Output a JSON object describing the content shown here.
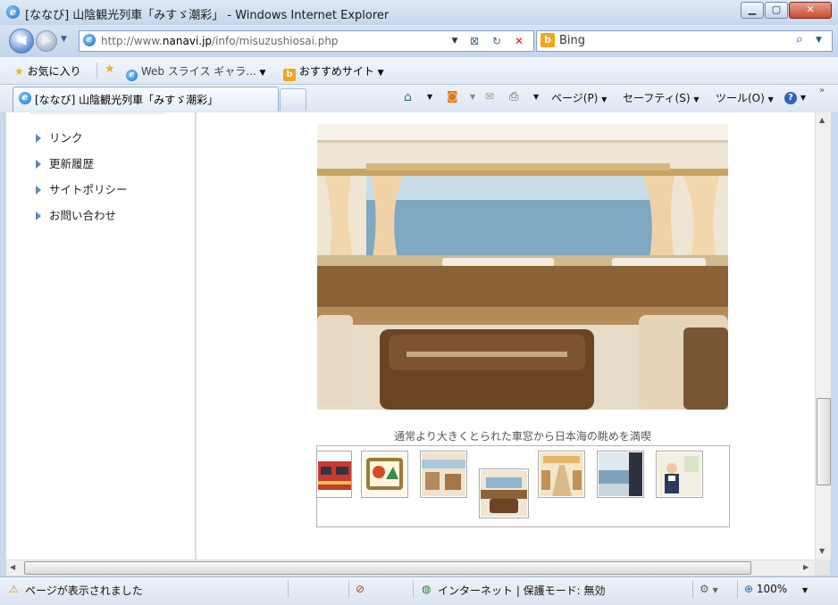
{
  "window": {
    "title": "[ななび] 山陰観光列車「みすゞ潮彩」 - Windows Internet Explorer"
  },
  "address_bar": {
    "url_prefix": "http://www.",
    "url_domain": "nanavi.jp",
    "url_path": "/info/misuzushiosai.php"
  },
  "search": {
    "provider": "Bing"
  },
  "favorites_bar": {
    "favorites_label": "お気に入り",
    "web_slice_label": "Web スライス ギャラ...",
    "suggested_sites_label": "おすすめサイト"
  },
  "tab": {
    "title": "[ななび] 山陰観光列車「みすゞ潮彩」"
  },
  "command_bar": {
    "page_label": "ページ(P)",
    "safety_label": "セーフティ(S)",
    "tools_label": "ツール(O)"
  },
  "sidebar": {
    "items": [
      {
        "label": "リンク"
      },
      {
        "label": "更新履歴"
      },
      {
        "label": "サイトポリシー"
      },
      {
        "label": "お問い合わせ"
      }
    ]
  },
  "gallery": {
    "caption": "通常より大きくとられた車窓から日本海の眺めを満喫",
    "thumbnails": [
      {
        "name": "train-exterior"
      },
      {
        "name": "train-sign"
      },
      {
        "name": "interior-seats"
      },
      {
        "name": "window-seat"
      },
      {
        "name": "interior-aisle"
      },
      {
        "name": "sea-view"
      },
      {
        "name": "staff"
      }
    ],
    "selected_index": 3
  },
  "status_bar": {
    "status_text": "ページが表示されました",
    "zone_text": "インターネット | 保護モード: 無効",
    "zoom_text": "100%"
  },
  "colors": {
    "frame": "#c9d9ee",
    "link_arrow": "#5c86c2"
  }
}
